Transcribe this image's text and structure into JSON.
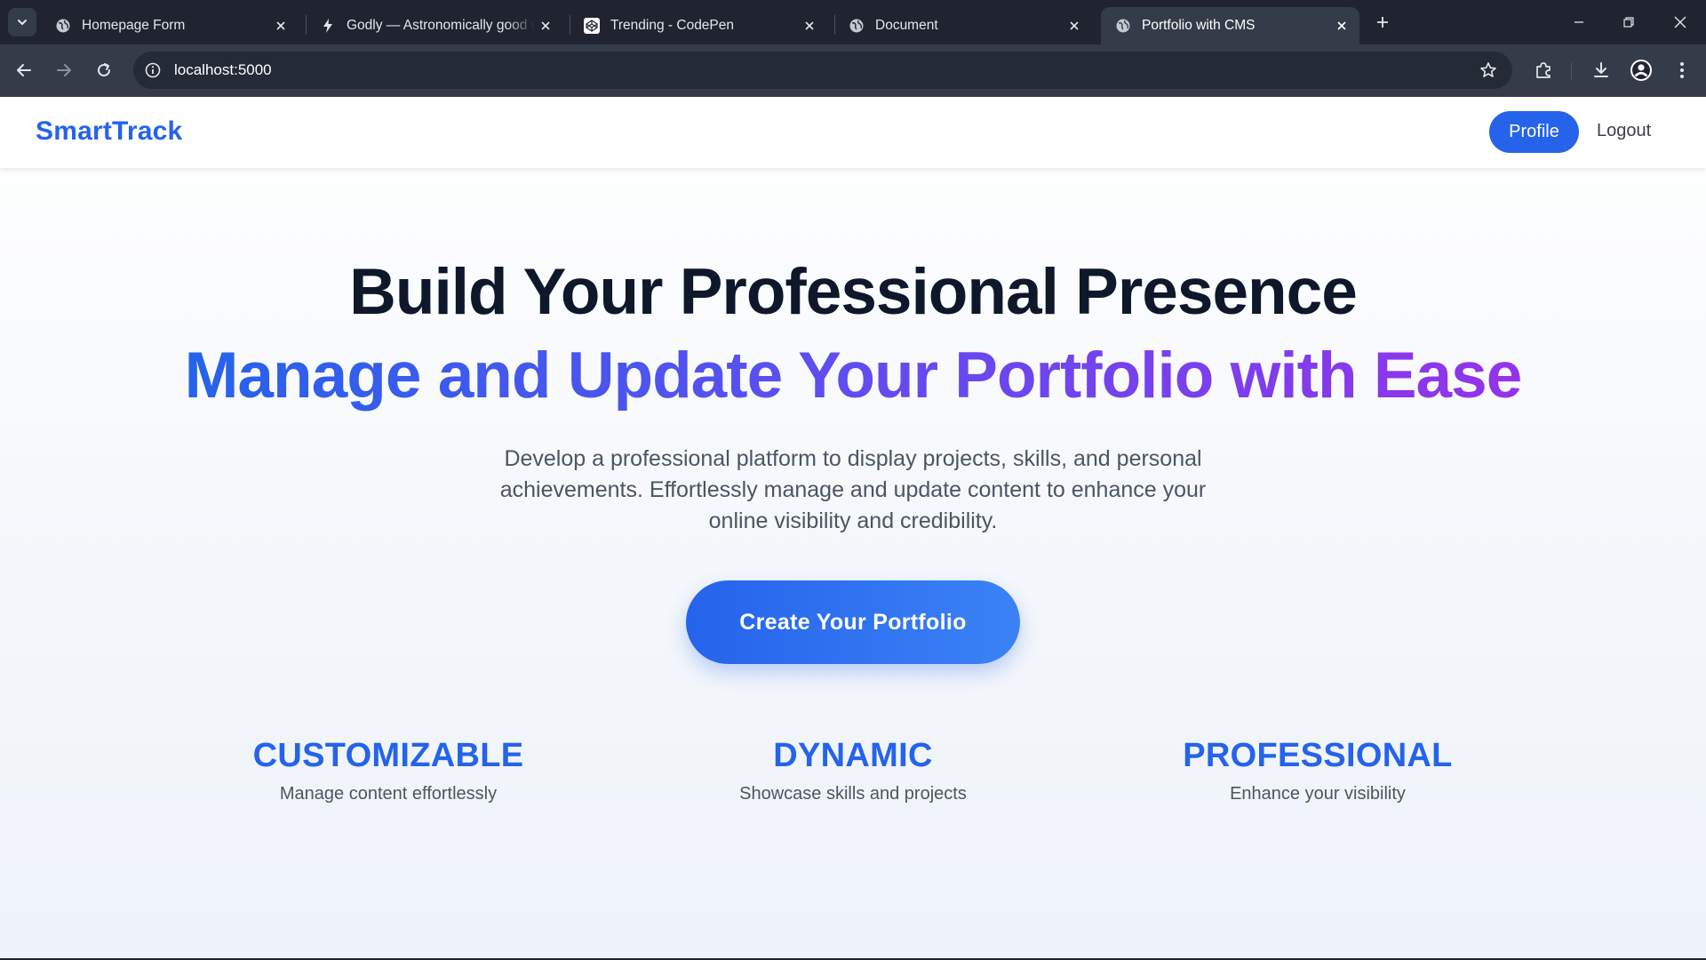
{
  "browser": {
    "tabs": [
      {
        "title": "Homepage Form",
        "icon": "globe-icon",
        "active": false
      },
      {
        "title": "Godly — Astronomically good web design",
        "icon": "bolt-icon",
        "active": false
      },
      {
        "title": "Trending - CodePen",
        "icon": "codepen-icon",
        "active": false
      },
      {
        "title": "Document",
        "icon": "globe-icon",
        "active": false
      },
      {
        "title": "Portfolio with CMS",
        "icon": "globe-icon",
        "active": true
      }
    ],
    "url": "localhost:5000"
  },
  "site": {
    "brand": "SmartTrack",
    "nav": {
      "profile": "Profile",
      "logout": "Logout"
    },
    "hero": {
      "title": "Build Your Professional Presence",
      "subtitle": "Manage and Update Your Portfolio with Ease",
      "description": "Develop a professional platform to display projects, skills, and personal achievements. Effortlessly manage and update content to enhance your online visibility and credibility.",
      "cta": "Create Your Portfolio"
    },
    "features": [
      {
        "title": "CUSTOMIZABLE",
        "description": "Manage content effortlessly"
      },
      {
        "title": "DYNAMIC",
        "description": "Showcase skills and projects"
      },
      {
        "title": "PROFESSIONAL",
        "description": "Enhance your visibility"
      }
    ]
  },
  "colors": {
    "brand_blue": "#2563eb",
    "gradient_end_purple": "#9333ea",
    "browser_dark": "#1f2430",
    "browser_toolbar": "#343b49"
  }
}
